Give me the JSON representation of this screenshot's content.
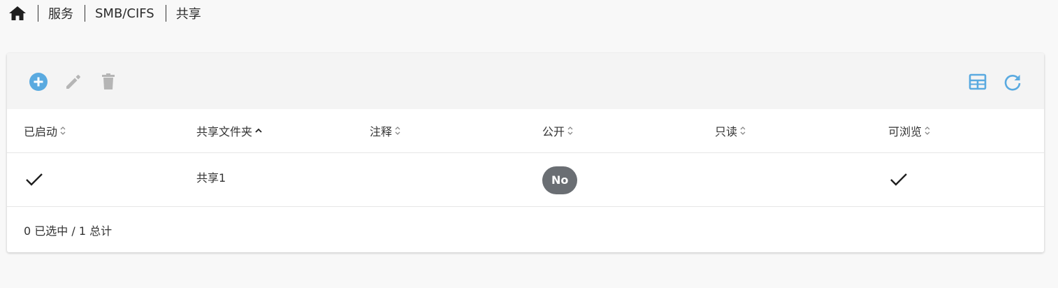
{
  "breadcrumb": {
    "items": [
      "服务",
      "SMB/CIFS",
      "共享"
    ]
  },
  "colors": {
    "accent": "#5aaae0",
    "disabled": "#b5b5b5",
    "badge": "#6a6e73"
  },
  "toolbar": {
    "add_icon": "add-circle-icon",
    "edit_icon": "pencil-icon",
    "delete_icon": "trash-icon",
    "columns_icon": "table-columns-icon",
    "refresh_icon": "refresh-icon"
  },
  "table": {
    "columns": [
      {
        "label": "已启动",
        "sort": "none"
      },
      {
        "label": "共享文件夹",
        "sort": "asc"
      },
      {
        "label": "注释",
        "sort": "none"
      },
      {
        "label": "公开",
        "sort": "none"
      },
      {
        "label": "只读",
        "sort": "none"
      },
      {
        "label": "可浏览",
        "sort": "none"
      }
    ],
    "rows": [
      {
        "enabled": true,
        "shared_folder": "共享1",
        "comment": "",
        "public": "No",
        "readonly": false,
        "browseable": true
      }
    ]
  },
  "footer": {
    "summary": "0 已选中 / 1 总计"
  }
}
